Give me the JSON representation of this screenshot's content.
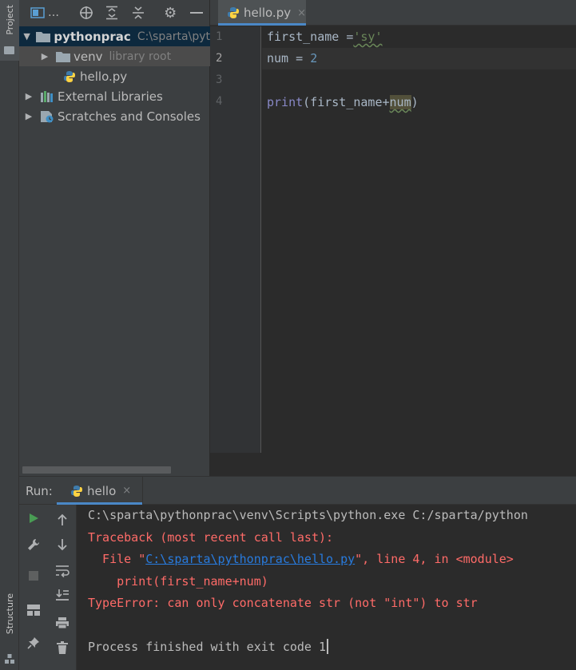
{
  "tool_stripe": {
    "project_label": "Project",
    "structure_label": "Structure"
  },
  "project_panel": {
    "toolbar": {
      "view_label": "…",
      "icons": [
        "project-view-icon",
        "locate-icon",
        "expand-all-icon",
        "collapse-all-icon",
        "gear-icon",
        "minimize-icon"
      ]
    },
    "tree": [
      {
        "label": "pythonprac",
        "path": "C:\\sparta\\pyt",
        "expanded": true
      },
      {
        "label": "venv",
        "note": "library root",
        "expanded": false
      },
      {
        "label": "hello.py"
      },
      {
        "label": "External Libraries",
        "expanded": false
      },
      {
        "label": "Scratches and Consoles",
        "expanded": false
      }
    ]
  },
  "editor": {
    "tab_label": "hello.py",
    "tab_close": "×",
    "line_numbers": [
      "1",
      "2",
      "3",
      "4"
    ],
    "code": {
      "line1_var": "first_name ",
      "line1_op": "=",
      "line1_str": "'sy'",
      "line2_var": "num = ",
      "line2_num": "2",
      "line4_kw": "print",
      "line4_open": "(first_name+",
      "line4_hl": "num",
      "line4_close": ")"
    }
  },
  "run_panel": {
    "label": "Run:",
    "tab_label": "hello",
    "tab_close": "×",
    "console": {
      "command": "C:\\sparta\\pythonprac\\venv\\Scripts\\python.exe C:/sparta/python",
      "traceback_header": "Traceback (most recent call last):",
      "file_prefix": "  File \"",
      "file_link": "C:\\sparta\\pythonprac\\hello.py",
      "file_suffix": "\", line 4, in <module>",
      "code_line": "    print(first_name+num)",
      "error": "TypeError: can only concatenate str (not \"int\") to str",
      "exit": "Process finished with exit code 1"
    }
  },
  "colors": {
    "background": "#2b2b2b",
    "panel": "#3c3f41",
    "accent": "#4a88c7",
    "error": "#ff6b68",
    "link": "#287bde",
    "run_green": "#499c54"
  }
}
